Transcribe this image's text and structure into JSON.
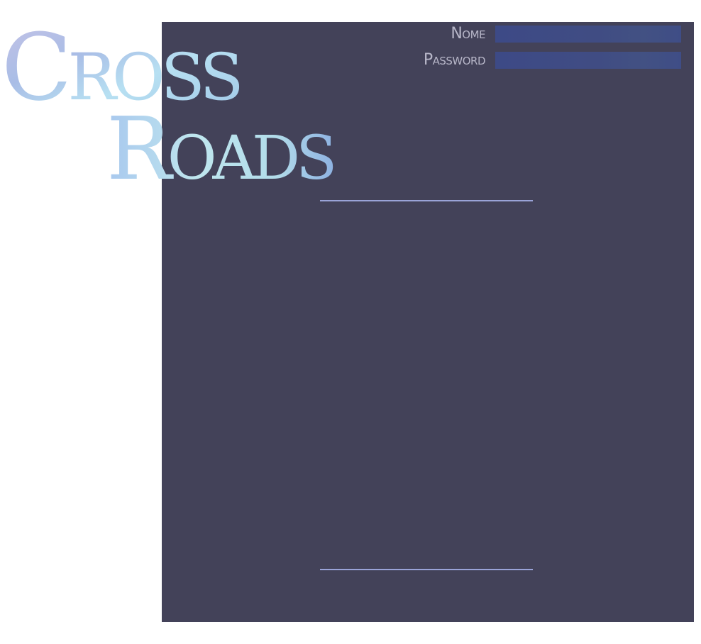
{
  "logo": {
    "line1": "Cross",
    "line2": "Roads"
  },
  "login": {
    "name_label": "Nome",
    "name_value": "",
    "password_label": "Password",
    "password_value": ""
  },
  "colors": {
    "panel": "#434259",
    "input_bg": "#3f4b86",
    "label": "#b7b6c8",
    "divider": "#9aa3d8",
    "logo_light": "#b6dff2",
    "logo_mid": "#8fb6e0",
    "logo_lilac": "#b8b4dc"
  }
}
